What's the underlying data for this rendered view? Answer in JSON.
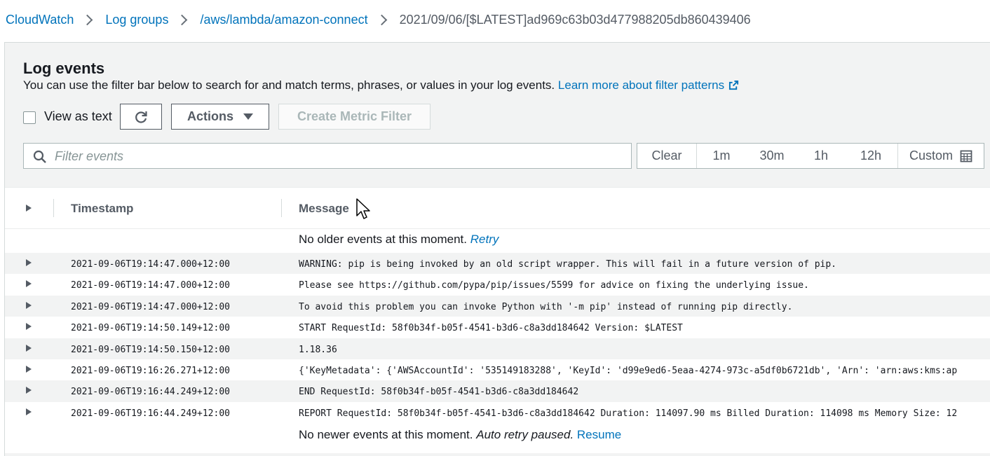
{
  "breadcrumb": {
    "items": [
      "CloudWatch",
      "Log groups",
      "/aws/lambda/amazon-connect"
    ],
    "current": "2021/09/06/[$LATEST]ad969c63b03d477988205db860439406"
  },
  "panel": {
    "title": "Log events",
    "description": "You can use the filter bar below to search for and match terms, phrases, or values in your log events.",
    "learn_more": "Learn more about filter patterns"
  },
  "toolbar": {
    "view_as_text": "View as text",
    "actions": "Actions",
    "create_metric_filter": "Create Metric Filter"
  },
  "filter": {
    "placeholder": "Filter events",
    "value": ""
  },
  "time_range": {
    "clear": "Clear",
    "options": [
      "1m",
      "30m",
      "1h",
      "12h"
    ],
    "custom": "Custom"
  },
  "table": {
    "columns": [
      "Timestamp",
      "Message"
    ],
    "older_text": "No older events at this moment.",
    "older_link": "Retry",
    "newer_text": "No newer events at this moment.",
    "newer_italic": "Auto retry paused.",
    "newer_link": "Resume",
    "rows": [
      {
        "timestamp": "2021-09-06T19:14:47.000+12:00",
        "message": "WARNING: pip is being invoked by an old script wrapper. This will fail in a future version of pip."
      },
      {
        "timestamp": "2021-09-06T19:14:47.000+12:00",
        "message": "Please see https://github.com/pypa/pip/issues/5599 for advice on fixing the underlying issue."
      },
      {
        "timestamp": "2021-09-06T19:14:47.000+12:00",
        "message": "To avoid this problem you can invoke Python with '-m pip' instead of running pip directly."
      },
      {
        "timestamp": "2021-09-06T19:14:50.149+12:00",
        "message": "START RequestId: 58f0b34f-b05f-4541-b3d6-c8a3dd184642 Version: $LATEST"
      },
      {
        "timestamp": "2021-09-06T19:14:50.150+12:00",
        "message": "1.18.36"
      },
      {
        "timestamp": "2021-09-06T19:16:26.271+12:00",
        "message": "{'KeyMetadata': {'AWSAccountId': '535149183288', 'KeyId': 'd99e9ed6-5eaa-4274-973c-a5df0b6721db', 'Arn': 'arn:aws:kms:ap"
      },
      {
        "timestamp": "2021-09-06T19:16:44.249+12:00",
        "message": "END RequestId: 58f0b34f-b05f-4541-b3d6-c8a3dd184642"
      },
      {
        "timestamp": "2021-09-06T19:16:44.249+12:00",
        "message": "REPORT RequestId: 58f0b34f-b05f-4541-b3d6-c8a3dd184642 Duration: 114097.90 ms Billed Duration: 114098 ms Memory Size: 12"
      }
    ]
  },
  "colors": {
    "link": "#0073bb",
    "panel_bg": "#f2f3f3",
    "border": "#aab7b8",
    "text": "#16191f",
    "muted": "#545b64"
  }
}
